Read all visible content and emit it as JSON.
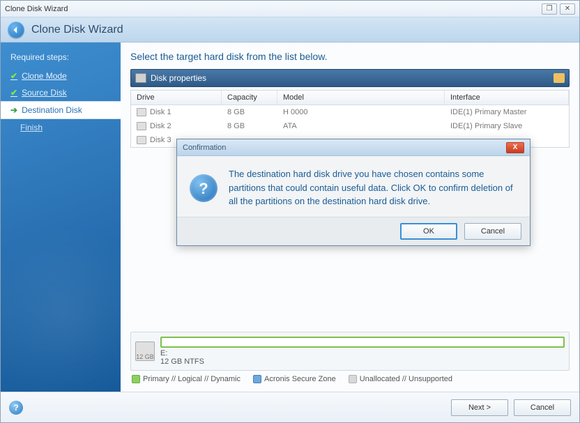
{
  "window": {
    "title": "Clone Disk Wizard"
  },
  "header": {
    "title": "Clone Disk Wizard"
  },
  "sidebar": {
    "header": "Required steps:",
    "steps": [
      {
        "label": "Clone Mode",
        "state": "done"
      },
      {
        "label": "Source Disk",
        "state": "done"
      },
      {
        "label": "Destination Disk",
        "state": "current"
      },
      {
        "label": "Finish",
        "state": "pending"
      }
    ]
  },
  "main": {
    "title": "Select the target hard disk from the list below.",
    "propsbar": "Disk properties",
    "columns": {
      "drive": "Drive",
      "capacity": "Capacity",
      "model": "Model",
      "interface": "Interface"
    },
    "rows": [
      {
        "drive": "Disk 1",
        "capacity": "8 GB",
        "model": "H 0000",
        "interface": "IDE(1) Primary Master"
      },
      {
        "drive": "Disk 2",
        "capacity": "8 GB",
        "model": "ATA",
        "interface": "IDE(1) Primary Slave"
      },
      {
        "drive": "Disk 3",
        "capacity": "",
        "model": "",
        "interface": ""
      }
    ],
    "partition": {
      "size": "12 GB",
      "line1": "E:",
      "line2": "12 GB  NTFS"
    },
    "legend": {
      "primary": "Primary // Logical // Dynamic",
      "secure": "Acronis Secure Zone",
      "unalloc": "Unallocated // Unsupported"
    }
  },
  "footer": {
    "next": "Next >",
    "cancel": "Cancel"
  },
  "modal": {
    "title": "Confirmation",
    "message": "The destination hard disk drive you have chosen contains some partitions that could contain useful data. Click OK to confirm deletion of all the partitions on the destination hard disk drive.",
    "ok": "OK",
    "cancel": "Cancel"
  }
}
